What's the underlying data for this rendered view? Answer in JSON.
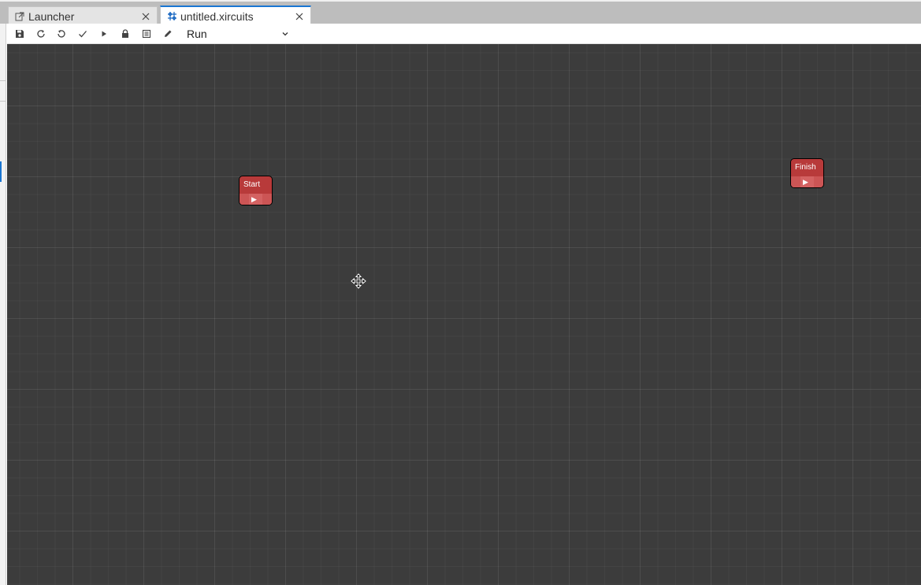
{
  "tabs": [
    {
      "label": "Launcher",
      "icon": "launcher-icon",
      "active": false
    },
    {
      "label": "untitled.xircuits",
      "icon": "xircuits-file-icon",
      "active": true
    }
  ],
  "toolbar": {
    "buttons": [
      "save-icon",
      "reload-icon",
      "undo-icon",
      "check-icon",
      "run-icon",
      "lock-icon",
      "table-icon",
      "edit-icon"
    ],
    "run_mode": "Run"
  },
  "canvas": {
    "nodes": [
      {
        "title": "Start",
        "port": "▶"
      },
      {
        "title": "Finish",
        "port": "▶"
      }
    ]
  },
  "colors": {
    "accent": "#1976d2",
    "node": "#b83a3a",
    "canvas": "#3c3c3c"
  }
}
